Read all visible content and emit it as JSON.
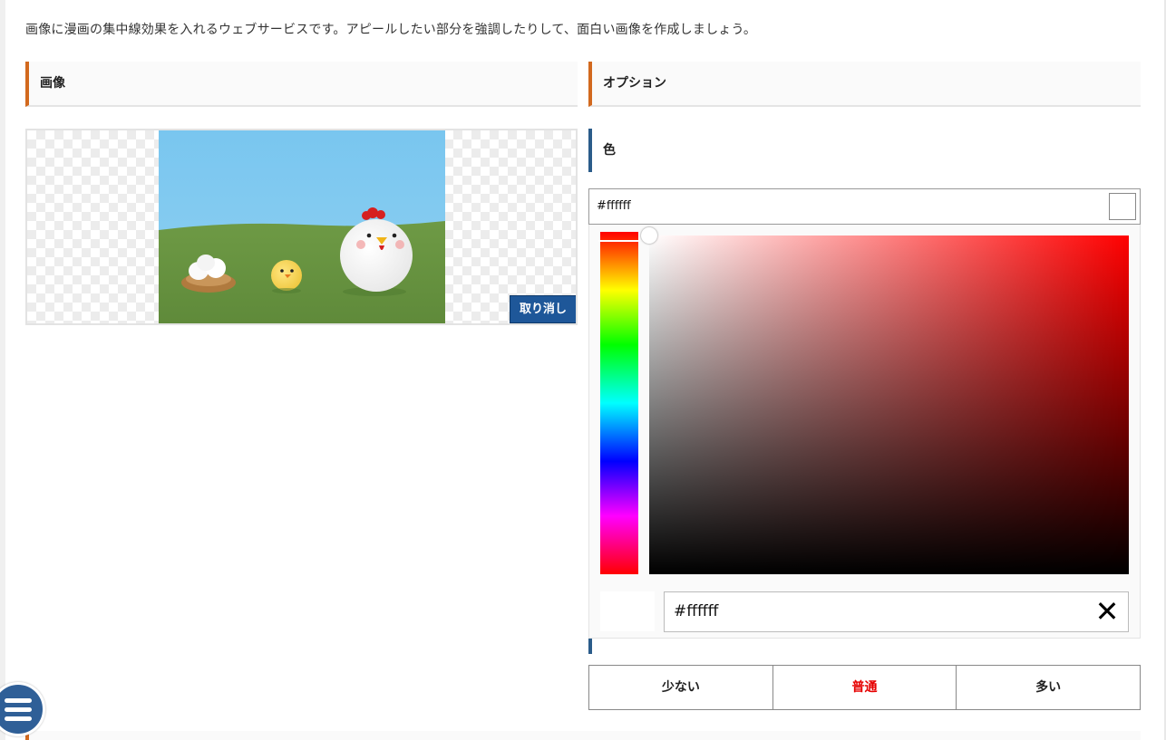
{
  "intro": "画像に漫画の集中線効果を入れるウェブサービスです。アピールしたい部分を強調したりして、面白い画像を作成しましょう。",
  "image_section": {
    "title": "画像",
    "cancel_label": "取り消し"
  },
  "option_section": {
    "title": "オプション",
    "color_heading": "色",
    "color_value": "#ffffff",
    "picker": {
      "hex_value": "#ffffff",
      "clear_symbol": "✕",
      "selected_color": "#ffffff"
    },
    "amount": {
      "options": [
        "少ない",
        "普通",
        "多い"
      ],
      "selected": "普通",
      "selected_color": "#e60000"
    }
  },
  "colors": {
    "section_accent": "#d2691e",
    "subsection_accent": "#2b5c8a",
    "button_blue": "#1e5799"
  }
}
